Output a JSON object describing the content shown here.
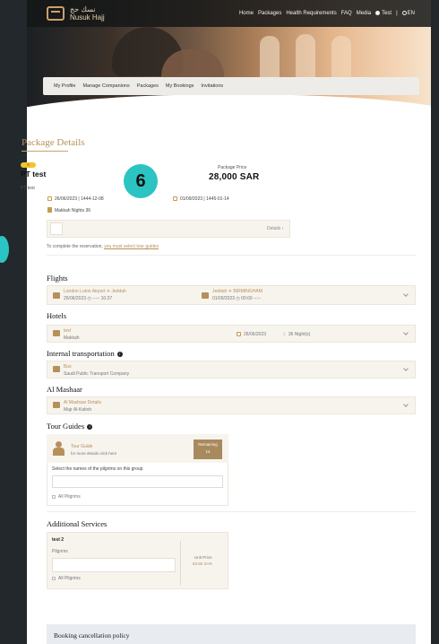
{
  "nav": {
    "logo_line1": "نسك حج",
    "logo_line2": "Nusuk Hajj",
    "links": [
      "Home",
      "Packages",
      "Health Requirements",
      "FAQ",
      "Media"
    ],
    "user": "Test",
    "lang": "EN"
  },
  "subtabs": [
    "My Profile",
    "Manage Companions",
    "Packages",
    "My Bookings",
    "Invitations"
  ],
  "page_title": "Package Details",
  "package": {
    "badge": "A",
    "name": "PT test",
    "subtitle": "PT test",
    "start_date": "26/06/2023 | 1444-12-08",
    "end_date": "01/09/2023 | 1445-01-14",
    "nights": "Makkah Nights 36",
    "price_label": "Package Price",
    "price": "28,000 SAR"
  },
  "step_number": "6",
  "details_link": "Details",
  "notice_text": "To complete the reservation,",
  "notice_link": "you must select tour guides",
  "sections": {
    "flights": "Flights",
    "hotels": "Hotels",
    "transport": "Internal transportation",
    "mashaar": "Al Mashaar",
    "tour_guides": "Tour Guides",
    "additional": "Additional Services"
  },
  "flights": {
    "outbound_route": "London Luton Airport  ✈  Jeddah",
    "outbound_time": "25/06/2023  ◷ --:--  10:37",
    "return_route": "Jeddah  ✈  BIRMINGHAM",
    "return_time": "01/09/2023  ◷ 00:00  --:--"
  },
  "hotel": {
    "name": "test",
    "city": "Makkah",
    "date": "26/06/2023",
    "nights": "36 Night(s)"
  },
  "transport": {
    "type": "Bus",
    "company": "Saudi Public Transport Company"
  },
  "mashaar": {
    "title": "Al Mashaar Details",
    "location": "Majr Al-Kabsh"
  },
  "tour_guide": {
    "title": "Tour Guide",
    "hint": "for more details click here",
    "remaining_label": "Remaining",
    "remaining_count": "14",
    "select_label": "Select the names of the pilgrims on this group",
    "all_pilgrims": "All Pilgrims"
  },
  "service": {
    "name": "test 2",
    "pilgrims_label": "Pilgrims",
    "unit_price_label": "Unit Price",
    "unit_price": "83.85 SAR",
    "all_pilgrims": "All Pilgrims"
  },
  "cancellation": "Booking cancellation policy"
}
